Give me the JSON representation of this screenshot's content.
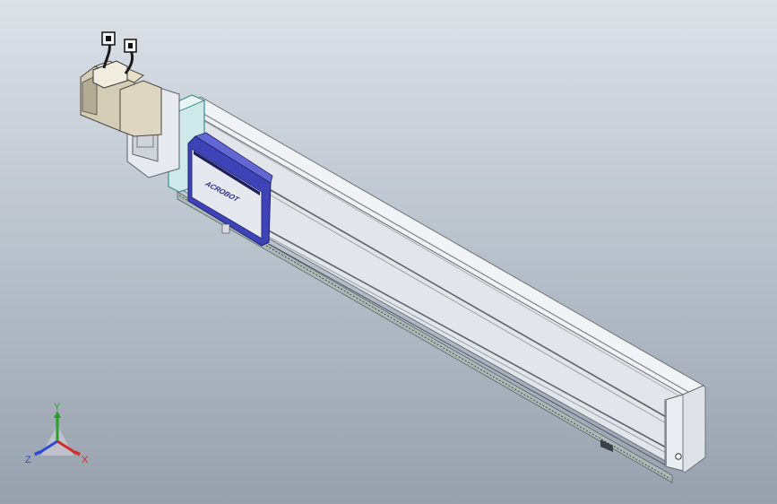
{
  "viewport": {
    "background_top": "#dde2e8",
    "background_bottom": "#97a1ad"
  },
  "model": {
    "carriage_logo_text": "ACROBOT",
    "accent_color": "#67c7c7",
    "carriage_color": "#3e43b8",
    "body_color": "#e7ebf0"
  },
  "triad": {
    "y_label": "Y",
    "x_label": "X",
    "z_label": "Z",
    "y_color": "#2aa02a",
    "x_color": "#d42a2a",
    "z_color": "#2a4ad4"
  }
}
